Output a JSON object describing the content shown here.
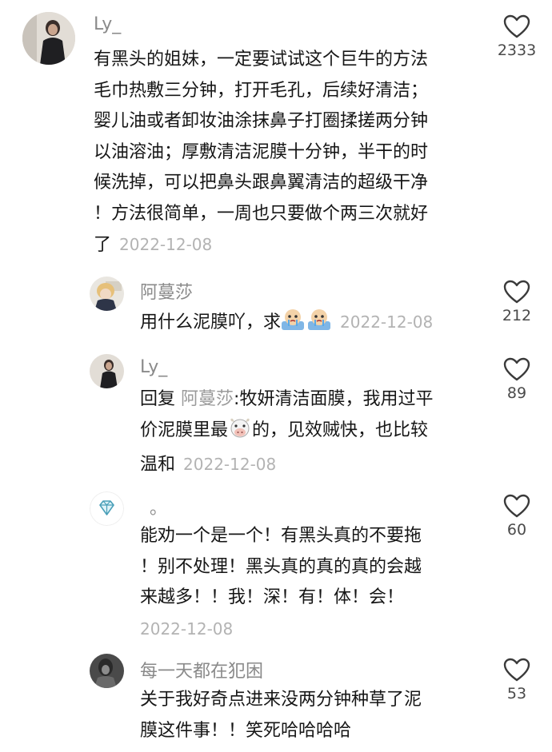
{
  "comments": [
    {
      "username": "Ly_",
      "lines": [
        "有黑头的姐妹，一定要试试这个巨牛的方法",
        "毛巾热敷三分钟，打开毛孔，后续好清洁；",
        "婴儿油或者卸妆油涂抹鼻子打圈揉搓两分钟",
        "以油溶油；厚敷清洁泥膜十分钟，半干的时",
        "候洗掉，可以把鼻头跟鼻翼清洁的超级干净",
        "！方法很简单，一周也只要做个两三次就好"
      ],
      "last_line": "了",
      "date": "2022-12-08",
      "likes": "2333"
    },
    {
      "username": "阿蔓莎",
      "text": "用什么泥膜吖，求",
      "emoji": "crying-emoji",
      "date": "2022-12-08",
      "likes": "212"
    },
    {
      "username": "Ly_",
      "reply_prefix": "回复",
      "reply_to": "阿蔓莎",
      "line1": ":牧妍清洁面膜，我用过平",
      "line2_a": "价泥膜里最",
      "emoji": "cow-emoji",
      "line2_b": "的，见效贼快，也比较",
      "last_line": "温和",
      "date": "2022-12-08",
      "likes": "89"
    },
    {
      "username": "。",
      "lines": [
        "能劝一个是一个！有黑头真的不要拖",
        "！别不处理！黑头真的真的真的会越",
        "来越多！！我！深！有！体！会！"
      ],
      "date": "2022-12-08",
      "likes": "60"
    },
    {
      "username": "每一天都在犯困",
      "lines": [
        "关于我好奇点进来没两分钟种草了泥",
        "膜这件事！！笑死哈哈哈哈"
      ],
      "likes": "53"
    }
  ],
  "icons": {
    "like": "heart-outline-icon"
  }
}
